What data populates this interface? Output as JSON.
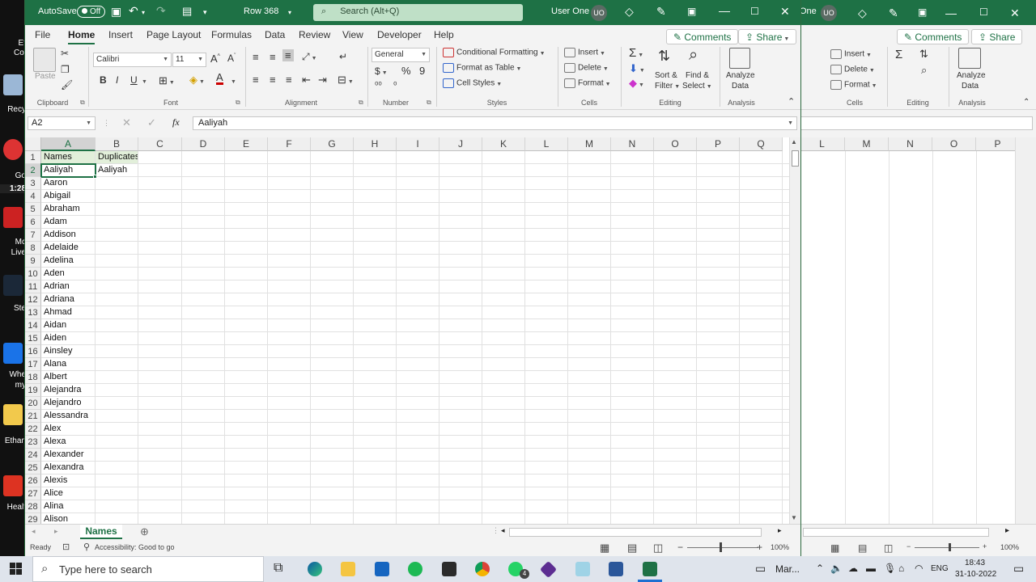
{
  "titlebar": {
    "autosave_label": "AutoSave",
    "autosave_state": "Off",
    "document_name": "Row 368",
    "search_placeholder": "Search (Alt+Q)",
    "user_name": "User One",
    "user_initials": "UO"
  },
  "menu": {
    "tabs": [
      "File",
      "Home",
      "Insert",
      "Page Layout",
      "Formulas",
      "Data",
      "Review",
      "View",
      "Developer",
      "Help"
    ],
    "active_tab": "Home",
    "comments_label": "Comments",
    "share_label": "Share"
  },
  "ribbon": {
    "clipboard": {
      "paste": "Paste",
      "label": "Clipboard"
    },
    "font": {
      "name": "Calibri",
      "size": "11",
      "label": "Font"
    },
    "alignment": {
      "label": "Alignment"
    },
    "number": {
      "format": "General",
      "label": "Number"
    },
    "styles": {
      "conditional": "Conditional Formatting",
      "format_table": "Format as Table",
      "cell_styles": "Cell Styles",
      "label": "Styles"
    },
    "cells": {
      "insert": "Insert",
      "delete": "Delete",
      "format": "Format",
      "label": "Cells"
    },
    "editing": {
      "sort_filter": "Sort &",
      "sort_filter2": "Filter",
      "find_select": "Find &",
      "find_select2": "Select",
      "label": "Editing"
    },
    "analysis": {
      "analyze1": "Analyze",
      "analyze2": "Data",
      "label": "Analysis"
    }
  },
  "formula_bar": {
    "name_box": "A2",
    "fx": "fx",
    "value": "Aaliyah"
  },
  "grid": {
    "columns": [
      "A",
      "B",
      "C",
      "D",
      "E",
      "F",
      "G",
      "H",
      "I",
      "J",
      "K",
      "L",
      "M",
      "N",
      "O",
      "P",
      "Q"
    ],
    "rows": [
      {
        "n": "1",
        "a": "Names",
        "b": "Duplicates"
      },
      {
        "n": "2",
        "a": "Aaliyah",
        "b": "Aaliyah"
      },
      {
        "n": "3",
        "a": "Aaron",
        "b": ""
      },
      {
        "n": "4",
        "a": "Abigail",
        "b": ""
      },
      {
        "n": "5",
        "a": "Abraham",
        "b": ""
      },
      {
        "n": "6",
        "a": "Adam",
        "b": ""
      },
      {
        "n": "7",
        "a": "Addison",
        "b": ""
      },
      {
        "n": "8",
        "a": "Adelaide",
        "b": ""
      },
      {
        "n": "9",
        "a": "Adelina",
        "b": ""
      },
      {
        "n": "10",
        "a": "Aden",
        "b": ""
      },
      {
        "n": "11",
        "a": "Adrian",
        "b": ""
      },
      {
        "n": "12",
        "a": "Adriana",
        "b": ""
      },
      {
        "n": "13",
        "a": "Ahmad",
        "b": ""
      },
      {
        "n": "14",
        "a": "Aidan",
        "b": ""
      },
      {
        "n": "15",
        "a": "Aiden",
        "b": ""
      },
      {
        "n": "16",
        "a": "Ainsley",
        "b": ""
      },
      {
        "n": "17",
        "a": "Alana",
        "b": ""
      },
      {
        "n": "18",
        "a": "Albert",
        "b": ""
      },
      {
        "n": "19",
        "a": "Alejandra",
        "b": ""
      },
      {
        "n": "20",
        "a": "Alejandro",
        "b": ""
      },
      {
        "n": "21",
        "a": "Alessandra",
        "b": ""
      },
      {
        "n": "22",
        "a": "Alex",
        "b": ""
      },
      {
        "n": "23",
        "a": "Alexa",
        "b": ""
      },
      {
        "n": "24",
        "a": "Alexander",
        "b": ""
      },
      {
        "n": "25",
        "a": "Alexandra",
        "b": ""
      },
      {
        "n": "26",
        "a": "Alexis",
        "b": ""
      },
      {
        "n": "27",
        "a": "Alice",
        "b": ""
      },
      {
        "n": "28",
        "a": "Alina",
        "b": ""
      },
      {
        "n": "29",
        "a": "Alison",
        "b": ""
      }
    ],
    "active_cell": "A2"
  },
  "sheet_tab": "Names",
  "status": {
    "ready": "Ready",
    "accessibility": "Accessibility: Good to go",
    "zoom": "100%"
  },
  "bg_window": {
    "user_partial": "One",
    "user_initials": "UO",
    "comments_label": "Comments",
    "share_label": "Share",
    "cells_label": "Cells",
    "editing_label": "Editing",
    "analysis_label": "Analysis",
    "insert": "Insert",
    "delete": "Delete",
    "format": "Format",
    "analyze1": "Analyze",
    "analyze2": "Data",
    "columns": [
      "L",
      "M",
      "N",
      "O",
      "P"
    ],
    "zoom": "100%"
  },
  "desktop": {
    "labels": [
      "Et",
      "Col",
      "Recy",
      "Go",
      "1:28",
      "Mc",
      "Live",
      "Ste",
      "Whe",
      "my",
      "Ethan",
      "Healt"
    ]
  },
  "taskbar": {
    "search_placeholder": "Type here to search",
    "active_app_label": "Mar...",
    "language": "ENG",
    "time": "18:43",
    "date": "31-10-2022",
    "whatsapp_badge": "4"
  },
  "colors": {
    "excel_green": "#1e7145",
    "header_fill": "#e2efda"
  }
}
